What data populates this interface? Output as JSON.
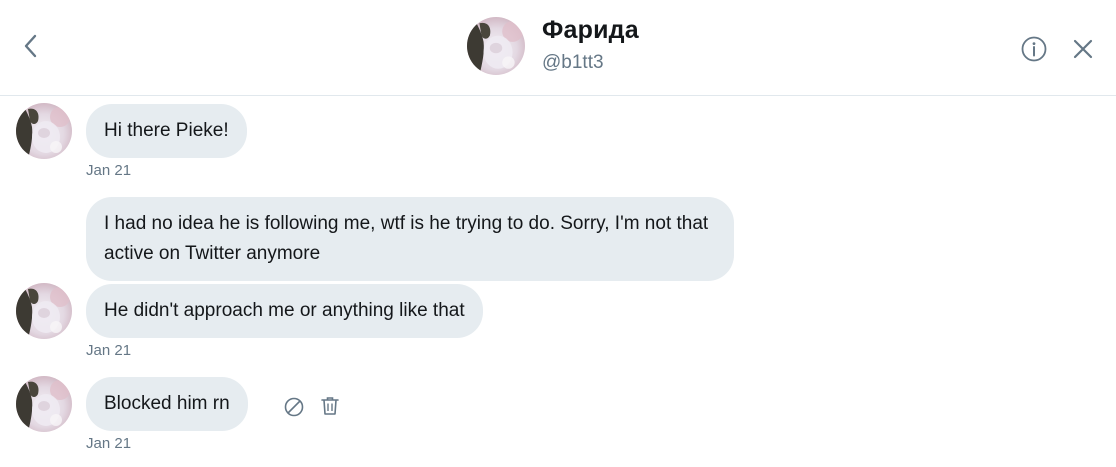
{
  "header": {
    "name": "Фарида",
    "handle": "@b1tt3"
  },
  "messages": [
    {
      "text": "Hi there Pieke!",
      "timestamp": "Jan 21"
    },
    {
      "text": "I had no idea he is following me, wtf is he trying to do. Sorry, I'm not that active on Twitter anymore"
    },
    {
      "text": "He didn't approach me or anything like that",
      "timestamp": "Jan 21"
    },
    {
      "text": "Blocked him rn",
      "timestamp": "Jan 21"
    }
  ],
  "icons": {
    "back": "chevron-left-icon",
    "info": "info-icon",
    "close": "close-icon",
    "block": "block-icon",
    "delete": "trash-icon"
  },
  "colors": {
    "bubble": "#e6ecf0",
    "secondary_text": "#657786",
    "icon": "#657786"
  }
}
